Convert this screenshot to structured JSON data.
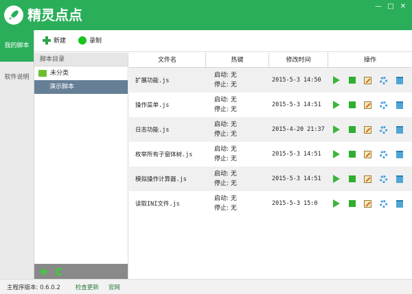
{
  "app": {
    "title": "精灵点点",
    "logo_icon": "rocket-icon",
    "accent": "#2aae5a"
  },
  "window_controls": {
    "minimize": "—",
    "maximize": "□",
    "close": "✕"
  },
  "left_tabs": [
    {
      "label": "我的脚本",
      "active": true
    },
    {
      "label": "软件说明",
      "active": false
    }
  ],
  "toolbar": {
    "new_label": "新建",
    "record_label": "录制"
  },
  "directory": {
    "header": "脚本目录",
    "folder": "未分类",
    "selected": "演示脚本"
  },
  "table": {
    "headers": [
      "文件名",
      "热键",
      "修改时间",
      "操作"
    ],
    "rows": [
      {
        "name": "扩展功能.js",
        "start": "启动: 无",
        "stop": "停止: 无",
        "modified": "2015-5-3 14:50"
      },
      {
        "name": "操作菜单.js",
        "start": "启动: 无",
        "stop": "停止: 无",
        "modified": "2015-5-3 14:51"
      },
      {
        "name": "日志功能.js",
        "start": "启动: 无",
        "stop": "停止: 无",
        "modified": "2015-4-20 21:37"
      },
      {
        "name": "枚举所有子窗体树.js",
        "start": "启动: 无",
        "stop": "停止: 无",
        "modified": "2015-5-3 14:51"
      },
      {
        "name": "模拟操作计算器.js",
        "start": "启动: 无",
        "stop": "停止: 无",
        "modified": "2015-5-3 14:51"
      },
      {
        "name": "读取INI文件.js",
        "start": "启动: 无",
        "stop": "停止: 无",
        "modified": "2015-5-3 15:0"
      }
    ]
  },
  "status": {
    "version": "主程序版本: 0.6.0.2",
    "check_update": "检查更新",
    "website": "官网"
  }
}
